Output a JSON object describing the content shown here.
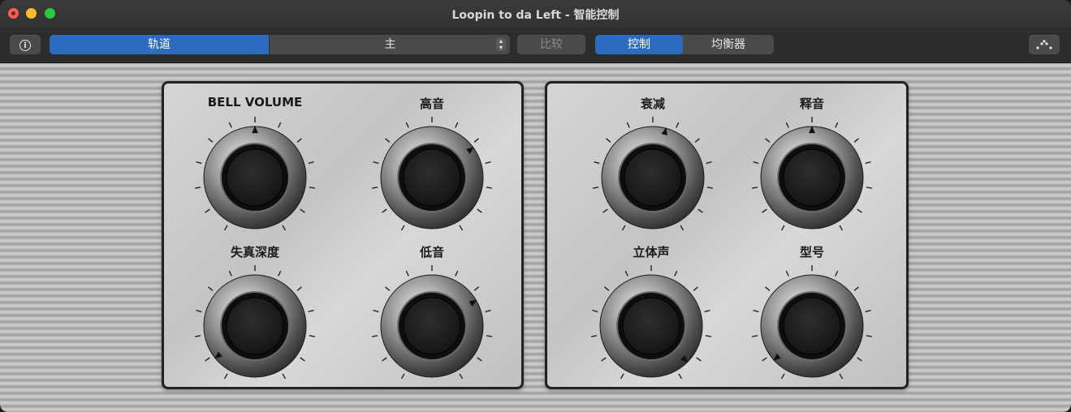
{
  "window": {
    "title": "Loopin to da Left - 智能控制"
  },
  "toolbar": {
    "info_icon": "info-icon",
    "track_label": "轨道",
    "main_label": "主",
    "compare_label": "比较",
    "control_label": "控制",
    "eq_label": "均衡器",
    "dots_icon": "dots-icon"
  },
  "colors": {
    "accent": "#2d6bc0",
    "panel": "#cdcdcd",
    "knob": "#1c1c1c"
  },
  "knobs": [
    {
      "label": "BELL VOLUME",
      "value": 0.5
    },
    {
      "label": "高音",
      "value": 0.68
    },
    {
      "label": "失真深度",
      "value": 0.07
    },
    {
      "label": "低音",
      "value": 0.7
    },
    {
      "label": "衰减",
      "value": 0.55
    },
    {
      "label": "释音",
      "value": 0.5
    },
    {
      "label": "立体声",
      "value": 0.95
    },
    {
      "label": "型号",
      "value": 0.06
    }
  ]
}
